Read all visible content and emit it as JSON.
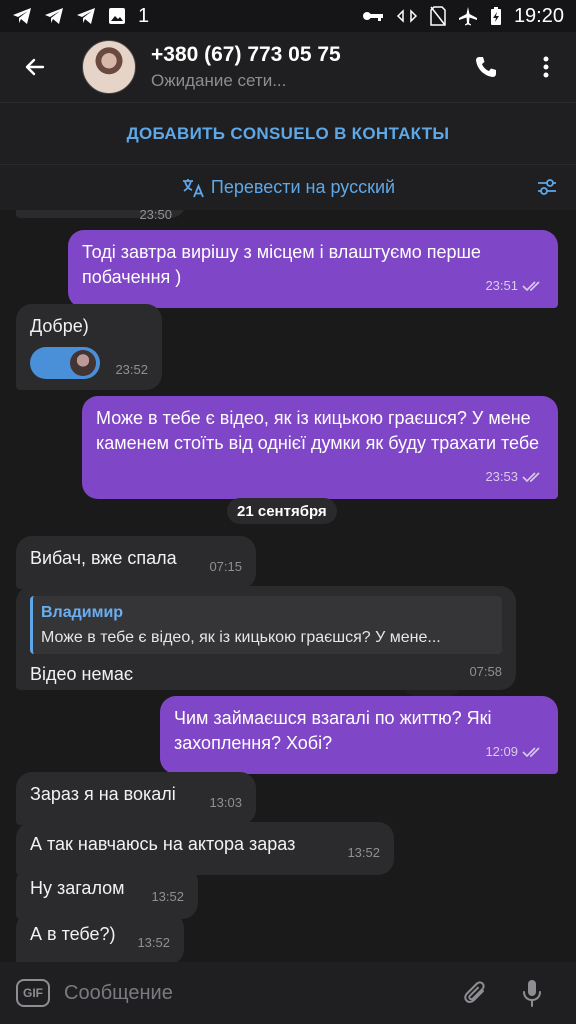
{
  "status_bar": {
    "left_icons": [
      "telegram-icon",
      "telegram-icon",
      "telegram-icon",
      "image-icon",
      "notification-1-icon"
    ],
    "notification_text": "1",
    "right_icons": [
      "key-icon",
      "data-arrows-icon",
      "no-sim-icon",
      "airplane-icon",
      "battery-icon"
    ],
    "time": "19:20"
  },
  "header": {
    "title": "+380 (67) 773 05 75",
    "subtitle": "Ожидание сети..."
  },
  "add_contact_label": "ДОБАВИТЬ CONSUELO В КОНТАКТЫ",
  "translate_label": "Перевести на русский",
  "messages": [
    {
      "dir": "out",
      "text": "Тоді завтра вирішу з місцем і влаштуємо перше побачення )",
      "time": "23:51"
    },
    {
      "dir": "in",
      "text": "Добре)",
      "time": "23:52"
    },
    {
      "dir": "out",
      "text": "Може в тебе є відео, як із кицькою граєшся? У мене каменем стоїть від однієї думки як буду трахати тебе",
      "time": "23:53"
    },
    {
      "dir": "in",
      "text": "Вибач, вже спала",
      "time": "07:15"
    },
    {
      "dir": "in",
      "reply_name": "Владимир",
      "reply_text": "Може в тебе є відео, як із кицькою граєшся? У мене...",
      "text": "Відео немає",
      "time": "07:58"
    },
    {
      "dir": "out",
      "text": "Чим займаєшся взагалі по життю? Які захоплення? Хобі?",
      "time": "12:09"
    },
    {
      "dir": "in",
      "text": "Зараз я на вокалі",
      "time": "13:03"
    },
    {
      "dir": "in",
      "text": "А так навчаюсь на актора зараз",
      "time": "13:52"
    },
    {
      "dir": "in",
      "text": "Ну загалом",
      "time": "13:52"
    },
    {
      "dir": "in",
      "text": "А в тебе?)",
      "time": "13:52"
    }
  ],
  "date_separator": "21 сентября",
  "partial_top_time": "23:50",
  "input": {
    "gif_label": "GIF",
    "placeholder": "Сообщение"
  },
  "colors": {
    "accent": "#5ea8e8",
    "outgoing": "#8046c8",
    "incoming": "#2b2b2d"
  }
}
